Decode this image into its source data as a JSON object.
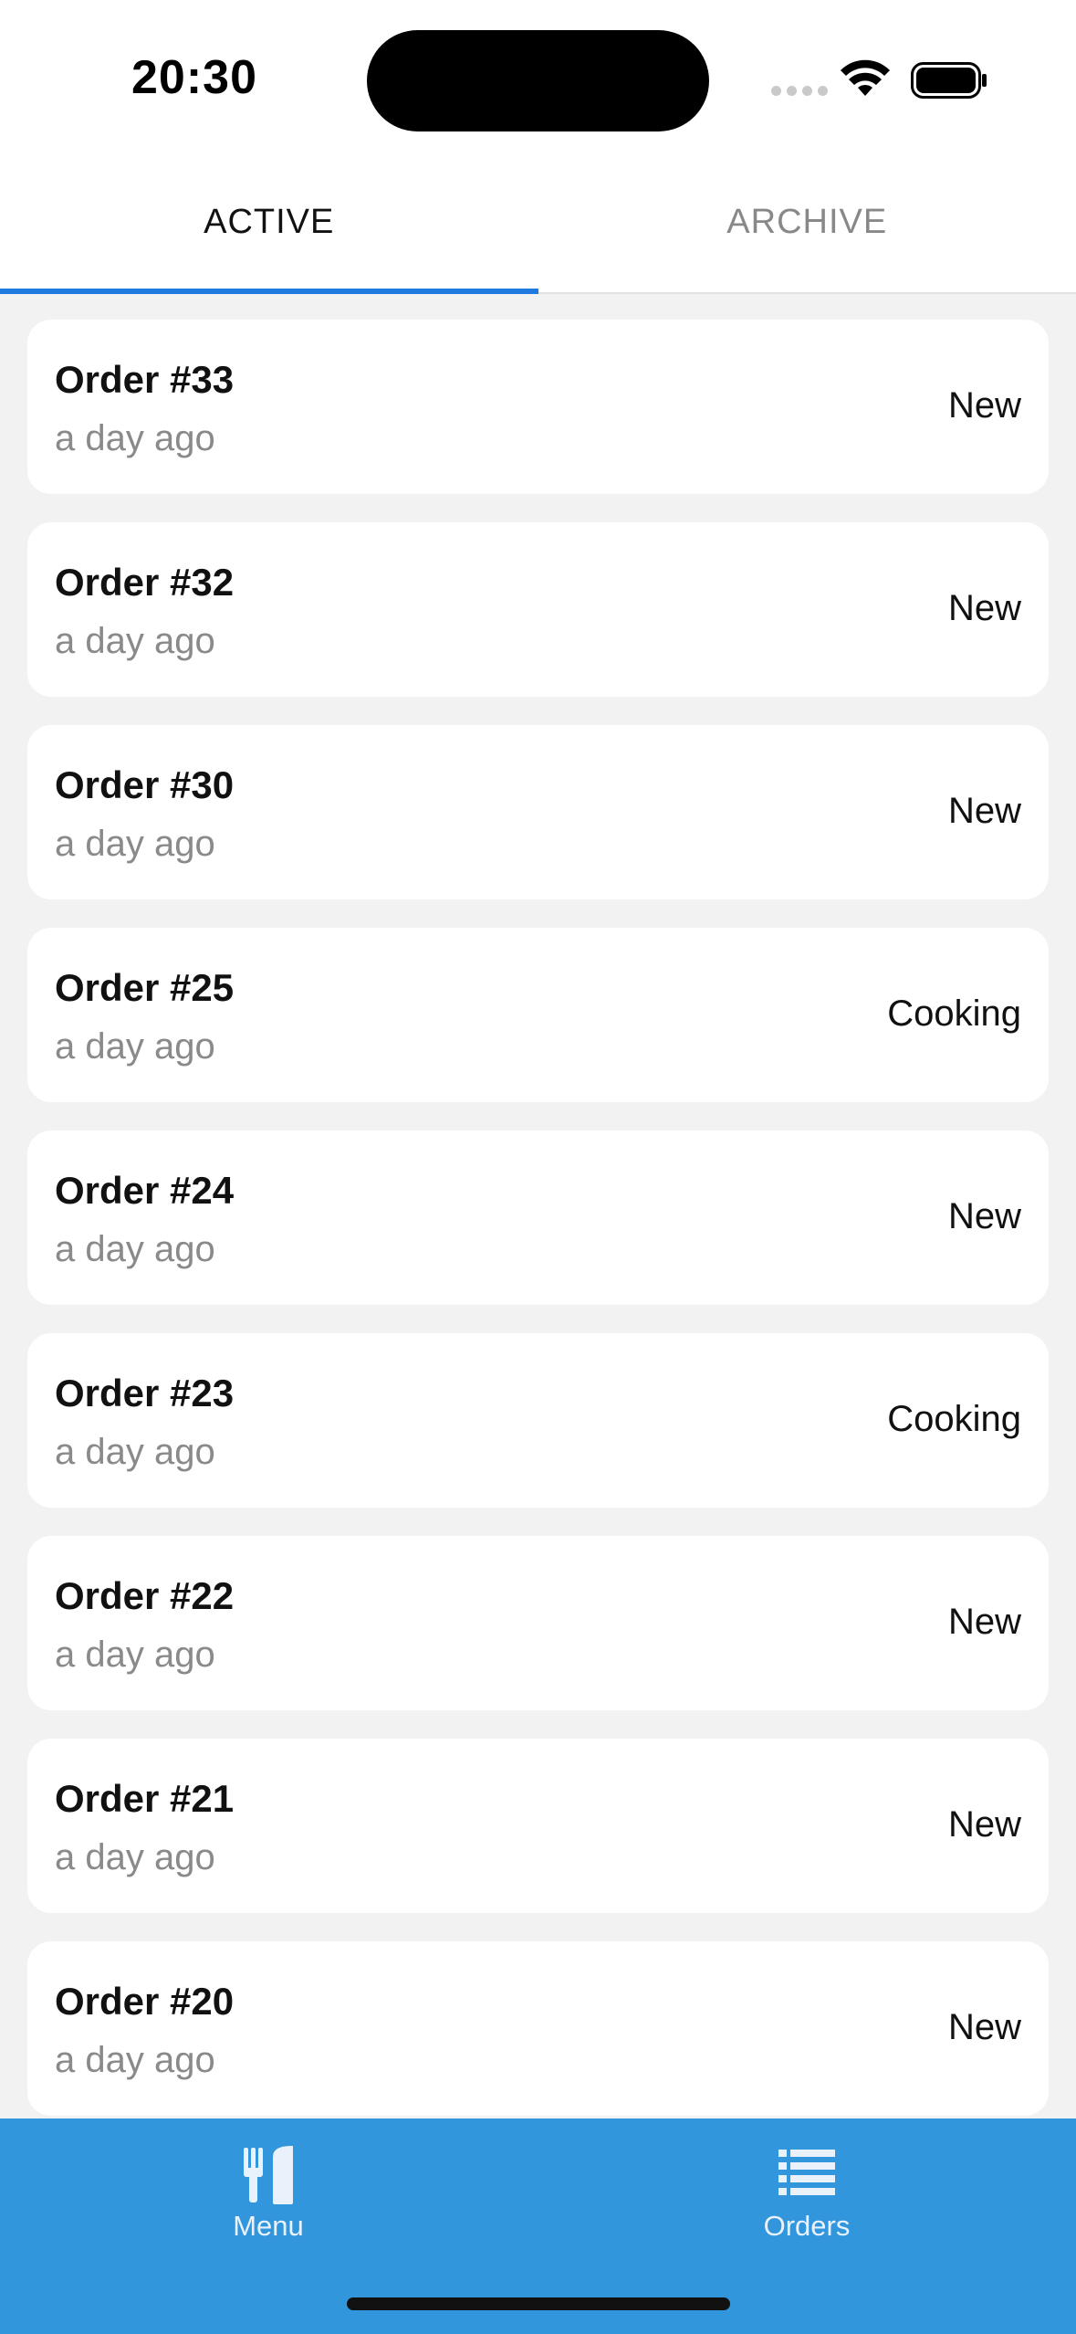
{
  "status_bar": {
    "time": "20:30"
  },
  "tabs": [
    {
      "label": "ACTIVE",
      "active": true
    },
    {
      "label": "ARCHIVE",
      "active": false
    }
  ],
  "orders": [
    {
      "title": "Order #33",
      "time": "a day ago",
      "status": "New"
    },
    {
      "title": "Order #32",
      "time": "a day ago",
      "status": "New"
    },
    {
      "title": "Order #30",
      "time": "a day ago",
      "status": "New"
    },
    {
      "title": "Order #25",
      "time": "a day ago",
      "status": "Cooking"
    },
    {
      "title": "Order #24",
      "time": "a day ago",
      "status": "New"
    },
    {
      "title": "Order #23",
      "time": "a day ago",
      "status": "Cooking"
    },
    {
      "title": "Order #22",
      "time": "a day ago",
      "status": "New"
    },
    {
      "title": "Order #21",
      "time": "a day ago",
      "status": "New"
    },
    {
      "title": "Order #20",
      "time": "a day ago",
      "status": "New"
    }
  ],
  "tabbar": {
    "menu": {
      "label": "Menu",
      "icon": "fork-knife-icon"
    },
    "orders": {
      "label": "Orders",
      "icon": "list-icon"
    }
  },
  "colors": {
    "accent": "#1f7ae0",
    "tabbar_background": "#3196dc"
  }
}
